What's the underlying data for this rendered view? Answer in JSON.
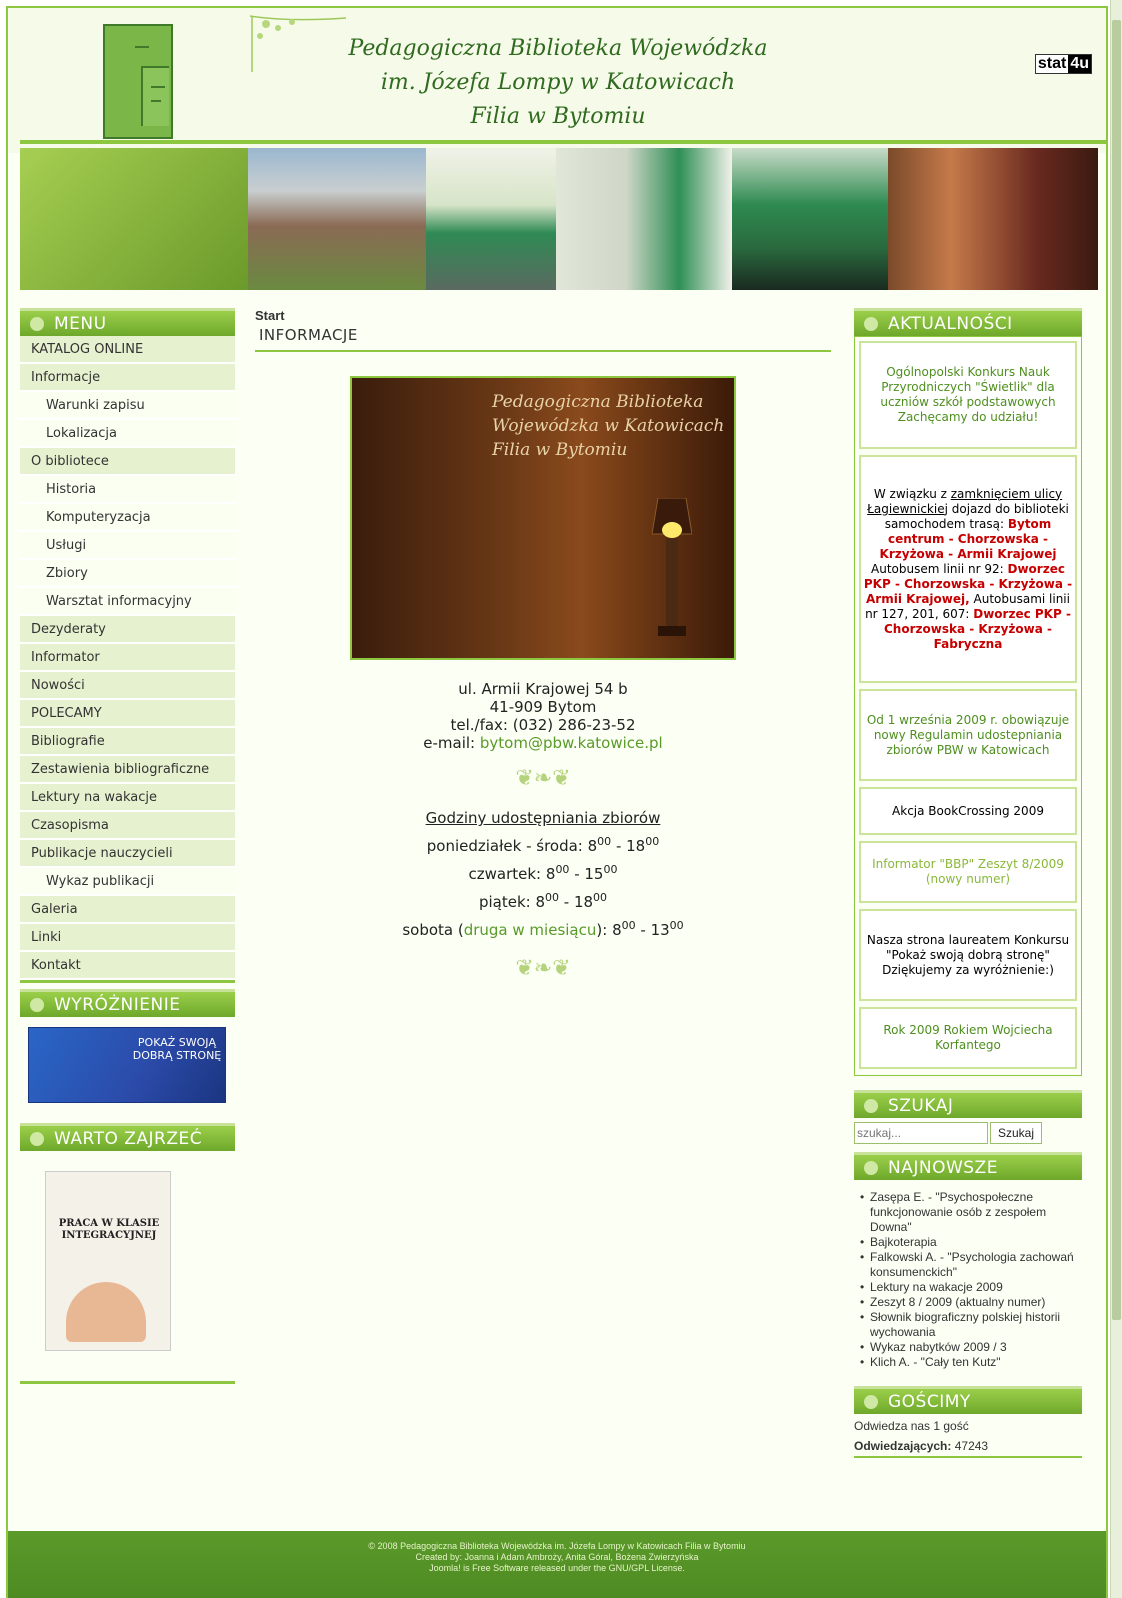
{
  "header": {
    "title_line1": "Pedagogiczna Biblioteka Wojewódzka",
    "title_line2": "im. Józefa Lompy w Katowicach",
    "title_line3": "Filia w Bytomiu",
    "stat_a": "stat",
    "stat_b": "4u"
  },
  "menu": {
    "heading": "MENU",
    "items": [
      {
        "label": "KATALOG ONLINE",
        "sub": false
      },
      {
        "label": "Informacje",
        "sub": false
      },
      {
        "label": "Warunki zapisu",
        "sub": true
      },
      {
        "label": "Lokalizacja",
        "sub": true
      },
      {
        "label": "O bibliotece",
        "sub": false
      },
      {
        "label": "Historia",
        "sub": true
      },
      {
        "label": "Komputeryzacja",
        "sub": true
      },
      {
        "label": "Usługi",
        "sub": true
      },
      {
        "label": "Zbiory",
        "sub": true
      },
      {
        "label": "Warsztat informacyjny",
        "sub": true
      },
      {
        "label": "Dezyderaty",
        "sub": false
      },
      {
        "label": "Informator",
        "sub": false
      },
      {
        "label": "Nowości",
        "sub": false
      },
      {
        "label": "POLECAMY",
        "sub": false
      },
      {
        "label": "Bibliografie",
        "sub": false
      },
      {
        "label": "Zestawienia bibliograficzne",
        "sub": false
      },
      {
        "label": "Lektury na wakacje",
        "sub": false
      },
      {
        "label": "Czasopisma",
        "sub": false
      },
      {
        "label": "Publikacje nauczycieli",
        "sub": false
      },
      {
        "label": "Wykaz publikacji",
        "sub": true
      },
      {
        "label": "Galeria",
        "sub": false
      },
      {
        "label": "Linki",
        "sub": false
      },
      {
        "label": "Kontakt",
        "sub": false
      }
    ]
  },
  "distinction": {
    "heading": "WYRÓŻNIENIE",
    "badge_text": "POKAŻ SWOJĄ DOBRĄ STRONĘ"
  },
  "worth": {
    "heading": "WARTO ZAJRZEĆ",
    "book_title": "PRACA W KLASIE INTEGRACYJNEJ"
  },
  "main": {
    "breadcrumb": "Start",
    "title": "INFORMACJE",
    "photo_text": "Pedagogiczna Biblioteka Wojewódzka w Katowicach Filia w Bytomiu",
    "address_line1": "ul. Armii Krajowej 54 b",
    "address_line2": "41-909 Bytom",
    "phone": "tel./fax: (032) 286-23-52",
    "email_label": "e-mail: ",
    "email": "bytom@pbw.katowice.pl",
    "hours_title": "Godziny udostępniania zbiorów",
    "hours": {
      "mon_wed_label": "poniedziałek - środa: ",
      "mon_wed_from": "8",
      "mon_wed_to": "18",
      "thu_label": "czwartek: ",
      "thu_from": "8",
      "thu_to": "15",
      "fri_label": "piątek: ",
      "fri_from": "8",
      "fri_to": "18",
      "sat_label_a": "sobota (",
      "sat_link": "druga w miesiącu",
      "sat_label_b": "): ",
      "sat_from": "8",
      "sat_to": "13",
      "minutes": "00",
      "dash": " - "
    }
  },
  "news": {
    "heading": "AKTUALNOŚCI",
    "item1": "Ogólnopolski Konkurs Nauk Przyrodniczych \"Świetlik\" dla uczniów szkół podstawowych Zachęcamy do udziału!",
    "item2": {
      "a": "W związku z ",
      "b": "zamknięciem ulicy Łagiewnickiej",
      "c": " dojazd do biblioteki samochodem trasą: ",
      "d": "Bytom centrum - Chorzowska - Krzyżowa - Armii Krajowej",
      "e": " Autobusem linii nr 92: ",
      "f": "Dworzec PKP - Chorzowska - Krzyżowa - Armii Krajowej,",
      "g": " Autobusami linii nr 127, 201, 607: ",
      "h": "Dworzec PKP - Chorzowska - Krzyżowa - Fabryczna"
    },
    "item3": "Od 1 września 2009 r. obowiązuje nowy Regulamin udostepniania zbiorów PBW w Katowicach",
    "item4": "Akcja BookCrossing 2009",
    "item5": "Informator \"BBP\" Zeszyt 8/2009 (nowy numer)",
    "item6": "Nasza strona laureatem Konkursu \"Pokaż swoją dobrą stronę\" Dziękujemy za wyróżnienie:)",
    "item7": "Rok 2009 Rokiem Wojciecha Korfantego"
  },
  "search": {
    "heading": "SZUKAJ",
    "placeholder": "szukaj...",
    "button": "Szukaj"
  },
  "latest": {
    "heading": "NAJNOWSZE",
    "items": [
      "Zasępa E. - \"Psychospołeczne funkcjonowanie osób z zespołem Downa\"",
      "Bajkoterapia",
      "Falkowski A. - \"Psychologia zachowań konsumenckich\"",
      "Lektury na wakacje 2009",
      "Zeszyt 8 / 2009 (aktualny numer)",
      "Słownik biograficzny polskiej historii wychowania",
      "Wykaz nabytków 2009 / 3",
      "Klich A. - \"Cały ten Kutz\""
    ]
  },
  "guests": {
    "heading": "GOŚCIMY",
    "online": "Odwiedza nas 1 gość",
    "visitors_label": "Odwiedzających:",
    "visitors_count": "47243"
  },
  "footer": {
    "line1": "© 2008 Pedagogiczna Biblioteka Wojewódzka im. Józefa Lompy w Katowicach Filia w Bytomiu",
    "line2": "Created by: Joanna i Adam Ambroży, Anita Góral, Bożena Zwierzyńska",
    "line3": "Joomla! is Free Software released under the GNU/GPL License."
  },
  "colors": {
    "accent": "#8dc63f",
    "heading_bg": "#7ab63a",
    "text_green": "#4e8f1f",
    "text_red": "#c60000"
  }
}
